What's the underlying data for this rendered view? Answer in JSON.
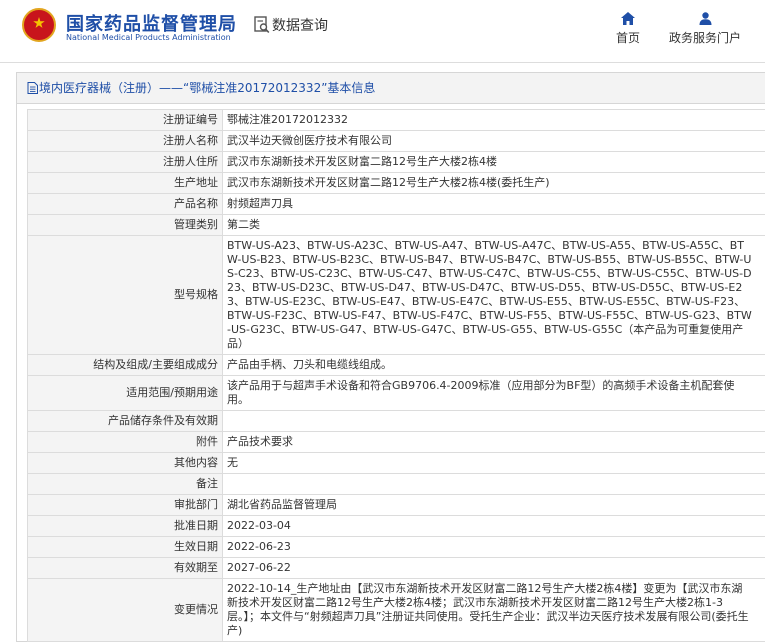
{
  "header": {
    "site_name": "国家药品监督管理局",
    "site_name_en": "National Medical Products Administration",
    "query_label": "数据查询",
    "nav": [
      {
        "label": "首页",
        "icon": "home-icon"
      },
      {
        "label": "政务服务门户",
        "icon": "user-icon"
      }
    ]
  },
  "breadcrumb": "境内医疗器械（注册）——“鄂械注准20172012332”基本信息",
  "records": [
    {
      "label": "注册证编号",
      "value": "鄂械注准20172012332"
    },
    {
      "label": "注册人名称",
      "value": "武汉半边天微创医疗技术有限公司"
    },
    {
      "label": "注册人住所",
      "value": "武汉市东湖新技术开发区财富二路12号生产大楼2栋4楼"
    },
    {
      "label": "生产地址",
      "value": "武汉市东湖新技术开发区财富二路12号生产大楼2栋4楼(委托生产)"
    },
    {
      "label": "产品名称",
      "value": "射频超声刀具"
    },
    {
      "label": "管理类别",
      "value": "第二类"
    },
    {
      "label": "型号规格",
      "value": "BTW-US-A23、BTW-US-A23C、BTW-US-A47、BTW-US-A47C、BTW-US-A55、BTW-US-A55C、BTW-US-B23、BTW-US-B23C、BTW-US-B47、BTW-US-B47C、BTW-US-B55、BTW-US-B55C、BTW-US-C23、BTW-US-C23C、BTW-US-C47、BTW-US-C47C、BTW-US-C55、BTW-US-C55C、BTW-US-D23、BTW-US-D23C、BTW-US-D47、BTW-US-D47C、BTW-US-D55、BTW-US-D55C、BTW-US-E23、BTW-US-E23C、BTW-US-E47、BTW-US-E47C、BTW-US-E55、BTW-US-E55C、BTW-US-F23、BTW-US-F23C、BTW-US-F47、BTW-US-F47C、BTW-US-F55、BTW-US-F55C、BTW-US-G23、BTW-US-G23C、BTW-US-G47、BTW-US-G47C、BTW-US-G55、BTW-US-G55C（本产品为可重复使用产品）"
    },
    {
      "label": "结构及组成/主要组成成分",
      "value": "产品由手柄、刀头和电缆线组成。"
    },
    {
      "label": "适用范围/预期用途",
      "value": "该产品用于与超声手术设备和符合GB9706.4-2009标准（应用部分为BF型）的高频手术设备主机配套使用。"
    },
    {
      "label": "产品储存条件及有效期",
      "value": ""
    },
    {
      "label": "附件",
      "value": "产品技术要求"
    },
    {
      "label": "其他内容",
      "value": "无"
    },
    {
      "label": "备注",
      "value": ""
    },
    {
      "label": "审批部门",
      "value": "湖北省药品监督管理局"
    },
    {
      "label": "批准日期",
      "value": "2022-03-04"
    },
    {
      "label": "生效日期",
      "value": "2022-06-23"
    },
    {
      "label": "有效期至",
      "value": "2027-06-22"
    },
    {
      "label": "变更情况",
      "value": "2022-10-14_生产地址由【武汉市东湖新技术开发区财富二路12号生产大楼2栋4楼】变更为【武汉市东湖新技术开发区财富二路12号生产大楼2栋4楼；武汉市东湖新技术开发区财富二路12号生产大楼2栋1-3层。】；本文件与“射频超声刀具”注册证共同使用。受托生产企业：武汉半边天医疗技术发展有限公司(委托生产)"
    }
  ],
  "colors": {
    "brand_blue": "#1f4fa7",
    "logo_red": "#c8141c"
  }
}
